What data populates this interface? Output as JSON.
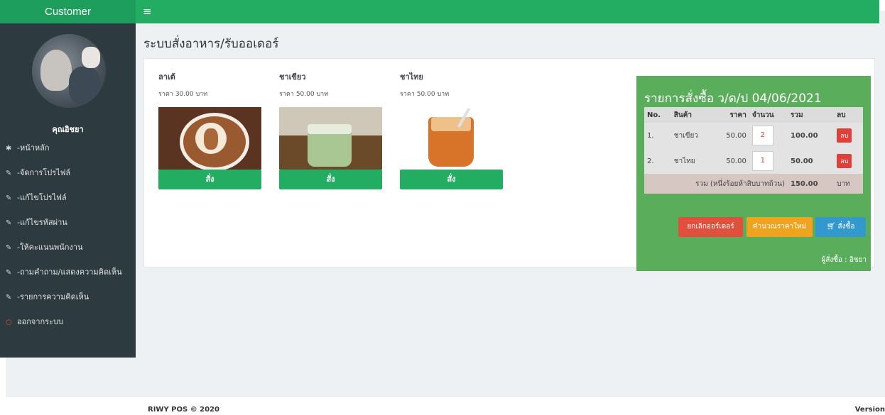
{
  "brand": "Customer",
  "topbar": {
    "menu_icon": "≡"
  },
  "sidebar": {
    "username": "คุณอิชยา",
    "items": [
      {
        "icon": "home-icon",
        "glyph": "✱",
        "label": "-หน้าหลัก"
      },
      {
        "icon": "edit-icon",
        "glyph": "✎",
        "label": "-จัดการโปรไฟล์"
      },
      {
        "icon": "edit-icon",
        "glyph": "✎",
        "label": "-แก้ไขโปรไฟล์"
      },
      {
        "icon": "edit-icon",
        "glyph": "✎",
        "label": "-แก้ไขรหัสผ่าน"
      },
      {
        "icon": "edit-icon",
        "glyph": "✎",
        "label": "-ให้คะแนนพนักงาน"
      },
      {
        "icon": "edit-icon",
        "glyph": "✎",
        "label": "-ถามคำถาม/แสดงความคิดเห็น"
      },
      {
        "icon": "edit-icon",
        "glyph": "✎",
        "label": "-รายการความคิดเห็น"
      },
      {
        "icon": "logout-icon",
        "glyph": "○",
        "label": "ออกจากระบบ"
      }
    ]
  },
  "main": {
    "title": "ระบบสั่งอาหาร/รับออเดอร์",
    "products": [
      {
        "name": "ลาเต้",
        "price": "ราคา 30.00 บาท",
        "button": "สั่ง"
      },
      {
        "name": "ชาเขียว",
        "price": "ราคา 50.00 บาท",
        "button": "สั่ง"
      },
      {
        "name": "ชาไทย",
        "price": "ราคา 50.00 บาท",
        "button": "สั่ง"
      }
    ]
  },
  "order": {
    "title": "รายการสั่งซื้อ ว/ด/ป 04/06/2021",
    "headers": [
      "No.",
      "สินค้า",
      "ราคา",
      "จำนวน",
      "รวม",
      "ลบ"
    ],
    "rows": [
      {
        "no": "1.",
        "name": "ชาเขียว",
        "price": "50.00",
        "qty": "2",
        "total": "100.00",
        "del": "ลบ"
      },
      {
        "no": "2.",
        "name": "ชาไทย",
        "price": "50.00",
        "qty": "1",
        "total": "50.00",
        "del": "ลบ"
      }
    ],
    "sum_label": "รวม (หนึ่งร้อยห้าสิบบาทถ้วน)",
    "sum_value": "150.00",
    "sum_unit": "บาท",
    "btn_cancel": "ยกเลิกออร์เดอร์",
    "btn_calc": "คำนวณราคาใหม่",
    "btn_order": "สั่งซื้อ",
    "buyer": "ผู้สั่งซื้อ : อิชยา"
  },
  "footer": {
    "left": "RIWY POS © 2020",
    "right": "Version"
  },
  "colors": {
    "brand_green": "#1e9e5c",
    "topbar_green": "#22ad62",
    "sidebar_bg": "#2d3a3f",
    "order_green": "#5aae5b"
  }
}
